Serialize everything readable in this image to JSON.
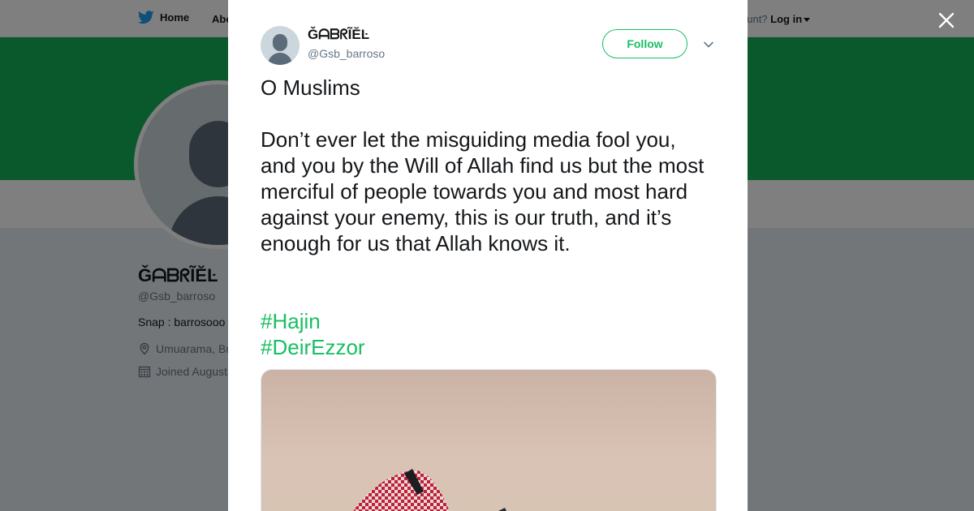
{
  "topbar": {
    "home_label": "Home",
    "about_label": "Abo",
    "account_prompt": "ccount?",
    "login_label": "Log in"
  },
  "profile": {
    "name": "ǦᗩᗷᖇĨĔĿ",
    "handle": "@Gsb_barroso",
    "bio": "Snap : barrosooo",
    "location": "Umuarama, Br",
    "joined": "Joined August"
  },
  "tweet": {
    "author_name": "ǦᗩᗷᖇĨĔĿ",
    "author_handle": "@Gsb_barroso",
    "follow_label": "Follow",
    "text": "O Muslims\n\nDon’t ever let the misguiding media fool you, and you by the Will of Allah find us but the most merciful of people towards you and most hard against your enemy, this is our truth, and it’s enough for us that Allah knows it.",
    "hashtags": [
      "#Hajin",
      "#DeirEzzor"
    ]
  },
  "colors": {
    "accent": "#17bf63",
    "banner": "#15b35a",
    "text_primary": "#14171a",
    "text_secondary": "#657786"
  },
  "icons": {
    "logo": "bird-icon",
    "close": "close-icon",
    "more": "chevron-down-icon",
    "location": "location-pin-icon",
    "joined": "calendar-icon"
  }
}
